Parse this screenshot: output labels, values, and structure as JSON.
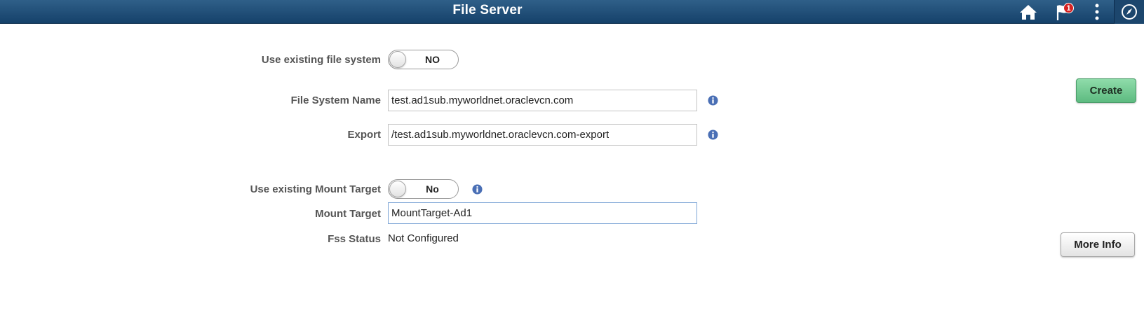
{
  "header": {
    "title": "File Server",
    "notification_count": "1",
    "icons": [
      "home-icon",
      "notification-flag-icon",
      "actions-menu-icon",
      "navbar-compass-icon"
    ],
    "colors": {
      "bar_top": "#2f5f88",
      "bar_bottom": "#15416a"
    }
  },
  "form": {
    "use_existing_fs": {
      "label": "Use existing file system",
      "value": "NO"
    },
    "fs_name": {
      "label": "File System Name",
      "value": "test.ad1sub.myworldnet.oraclevcn.com"
    },
    "export": {
      "label": "Export",
      "value": "/test.ad1sub.myworldnet.oraclevcn.com-export"
    },
    "use_existing_mt": {
      "label": "Use existing Mount Target",
      "value": "No"
    },
    "mount_target": {
      "label": "Mount Target",
      "value": "MountTarget-Ad1"
    },
    "fss_status": {
      "label": "Fss Status",
      "value": "Not Configured"
    }
  },
  "buttons": {
    "create": "Create",
    "more_info": "More Info"
  },
  "colors": {
    "info_icon": "#4a6fb5",
    "create_button": "#6cc98f"
  }
}
